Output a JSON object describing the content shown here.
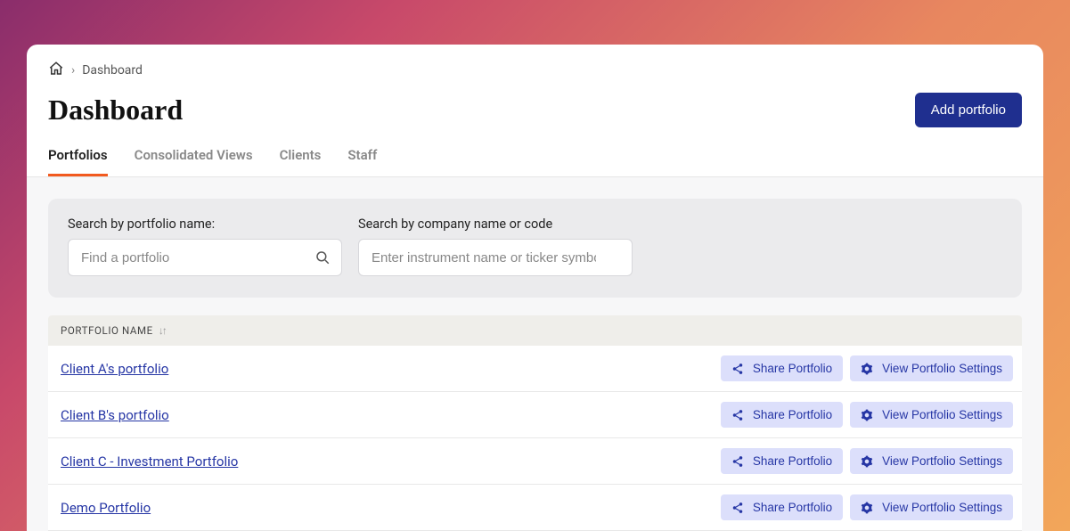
{
  "breadcrumb": {
    "current": "Dashboard"
  },
  "header": {
    "title": "Dashboard",
    "add_button": "Add portfolio"
  },
  "tabs": [
    {
      "label": "Portfolios",
      "active": true
    },
    {
      "label": "Consolidated Views",
      "active": false
    },
    {
      "label": "Clients",
      "active": false
    },
    {
      "label": "Staff",
      "active": false
    }
  ],
  "search": {
    "portfolio_label": "Search by portfolio name:",
    "portfolio_placeholder": "Find a portfolio",
    "company_label": "Search by company name or code",
    "company_placeholder": "Enter instrument name or ticker symbol"
  },
  "table": {
    "column_header": "PORTFOLIO NAME",
    "share_label": "Share Portfolio",
    "settings_label": "View Portfolio Settings",
    "rows": [
      {
        "name": "Client A's portfolio"
      },
      {
        "name": "Client B's portfolio"
      },
      {
        "name": "Client C - Investment Portfolio"
      },
      {
        "name": "Demo Portfolio"
      }
    ]
  }
}
